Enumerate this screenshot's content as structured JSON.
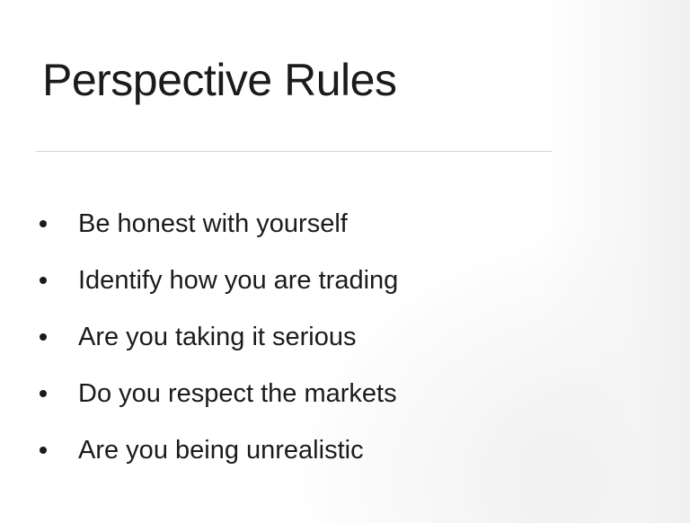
{
  "slide": {
    "title": "Perspective Rules",
    "bullets": [
      "Be honest with yourself",
      "Identify how you are trading",
      "Are you taking it serious",
      "Do you respect the markets",
      "Are you being unrealistic"
    ]
  },
  "colors": {
    "background": "#ffffff",
    "text": "#1b1b1b",
    "rule": "#d6d6d6"
  }
}
